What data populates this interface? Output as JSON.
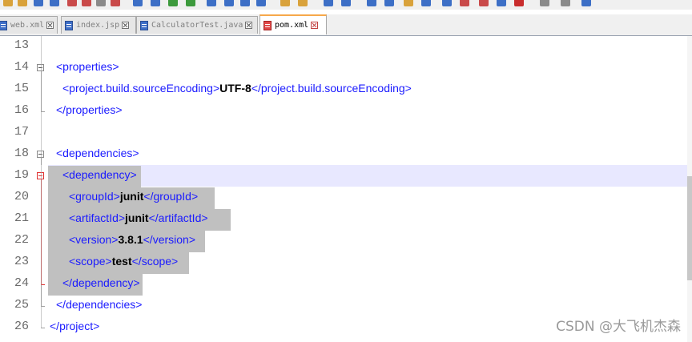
{
  "toolbar": {
    "icon_colors": [
      "#d9a23b",
      "#d9a23b",
      "#3d6fc6",
      "#3d6fc6",
      "#c94a4a",
      "#c94a4a",
      "#8a8a8a",
      "#c94a4a",
      "#3d6fc6",
      "#3d6fc6",
      "#3d9a3d",
      "#3d9a3d",
      "#3d6fc6",
      "#3d6fc6",
      "#3d6fc6",
      "#3d6fc6",
      "#d9a23b",
      "#d9a23b",
      "#3d6fc6",
      "#3d6fc6",
      "#3d6fc6",
      "#3d6fc6",
      "#d9a23b",
      "#3d6fc6",
      "#3d6fc6",
      "#c94a4a",
      "#c94a4a",
      "#3d6fc6",
      "#c92d2d",
      "#8a8a8a",
      "#8a8a8a",
      "#3d6fc6"
    ]
  },
  "tabs": [
    {
      "label": "web.xml",
      "active": false
    },
    {
      "label": "index.jsp",
      "active": false
    },
    {
      "label": "CalculatorTest.java",
      "active": false
    },
    {
      "label": "pom.xml",
      "active": true
    }
  ],
  "editor": {
    "lines": [
      {
        "number": "13",
        "segments": []
      },
      {
        "number": "14",
        "segments": [
          {
            "t": "tag",
            "v": "<properties>"
          }
        ]
      },
      {
        "number": "15",
        "segments": [
          {
            "t": "tag",
            "v": "<project.build.sourceEncoding>"
          },
          {
            "t": "txt",
            "v": "UTF-8"
          },
          {
            "t": "tag",
            "v": "</project.build.sourceEncoding>"
          }
        ]
      },
      {
        "number": "16",
        "segments": [
          {
            "t": "tag",
            "v": "</properties>"
          }
        ]
      },
      {
        "number": "17",
        "segments": []
      },
      {
        "number": "18",
        "segments": [
          {
            "t": "tag",
            "v": "<dependencies>"
          }
        ]
      },
      {
        "number": "19",
        "segments": [
          {
            "t": "tag",
            "v": "<dependency>"
          }
        ]
      },
      {
        "number": "20",
        "segments": [
          {
            "t": "tag",
            "v": "<groupId>"
          },
          {
            "t": "txt",
            "v": "junit"
          },
          {
            "t": "tag",
            "v": "</groupId>"
          }
        ]
      },
      {
        "number": "21",
        "segments": [
          {
            "t": "tag",
            "v": "<artifactId>"
          },
          {
            "t": "txt",
            "v": "junit"
          },
          {
            "t": "tag",
            "v": "</artifactId>"
          }
        ]
      },
      {
        "number": "22",
        "segments": [
          {
            "t": "tag",
            "v": "<version>"
          },
          {
            "t": "txt",
            "v": "3.8.1"
          },
          {
            "t": "tag",
            "v": "</version>"
          }
        ]
      },
      {
        "number": "23",
        "segments": [
          {
            "t": "tag",
            "v": "<scope>"
          },
          {
            "t": "txt",
            "v": "test"
          },
          {
            "t": "tag",
            "v": "</scope>"
          }
        ]
      },
      {
        "number": "24",
        "segments": [
          {
            "t": "tag",
            "v": "</dependency>"
          }
        ]
      },
      {
        "number": "25",
        "segments": [
          {
            "t": "tag",
            "v": "</dependencies>"
          }
        ]
      },
      {
        "number": "26",
        "segments": [
          {
            "t": "tag",
            "v": "</project>"
          }
        ]
      }
    ]
  },
  "watermark": "CSDN @大飞机杰森",
  "colors": {
    "tag": "#1a1aff",
    "text": "#000000",
    "selection": "#c0c0c0",
    "current_line": "#e8e8ff",
    "fold_active": "#e03030",
    "tab_active_accent": "#f7a84a"
  }
}
